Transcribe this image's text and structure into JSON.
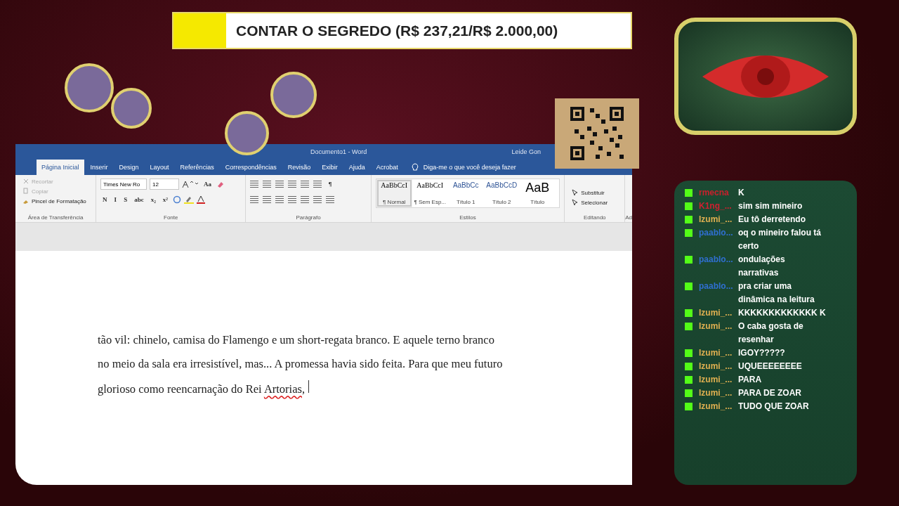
{
  "banner": {
    "title": "CONTAR O SEGREDO (R$ 237,21/R$ 2.000,00)"
  },
  "word": {
    "title": "Documento1 - Word",
    "user": "Leide Gon",
    "tabs": [
      {
        "label": "Página Inicial",
        "selected": true
      },
      {
        "label": "Inserir",
        "selected": false
      },
      {
        "label": "Design",
        "selected": false
      },
      {
        "label": "Layout",
        "selected": false
      },
      {
        "label": "Referências",
        "selected": false
      },
      {
        "label": "Correspondências",
        "selected": false
      },
      {
        "label": "Revisão",
        "selected": false
      },
      {
        "label": "Exibir",
        "selected": false
      },
      {
        "label": "Ajuda",
        "selected": false
      },
      {
        "label": "Acrobat",
        "selected": false
      }
    ],
    "tell_me": {
      "placeholder": "Diga-me o que você deseja fazer"
    },
    "clipboard": {
      "items": [
        {
          "label": "Recortar",
          "disabled": true
        },
        {
          "label": "Copiar",
          "disabled": true
        },
        {
          "label": "Pincel de Formatação",
          "disabled": false
        }
      ],
      "group": "Área de Transferência"
    },
    "font": {
      "name": "Times New Ro",
      "size": "12",
      "case_button": "Aa",
      "format_buttons": [
        "N",
        "I",
        "S",
        "abc",
        "x₂",
        "x²"
      ],
      "group": "Fonte"
    },
    "paragraph": {
      "group": "Parágrafo",
      "pilcrow": "¶"
    },
    "styles": {
      "group": "Estilos",
      "items": [
        {
          "preview": "AaBbCcI",
          "name": "¶ Normal",
          "kind": "body",
          "selected": true
        },
        {
          "preview": "AaBbCcI",
          "name": "¶ Sem Esp...",
          "kind": "body",
          "selected": false
        },
        {
          "preview": "AaBbCc",
          "name": "Título 1",
          "kind": "heading1",
          "selected": false
        },
        {
          "preview": "AaBbCcD",
          "name": "Título 2",
          "kind": "heading2",
          "selected": false
        },
        {
          "preview": "AaB",
          "name": "Título",
          "kind": "title",
          "selected": false
        }
      ]
    },
    "editing": {
      "group": "Editando",
      "items": [
        "Substituir",
        "Selecionar"
      ],
      "cut_label": "Ad"
    },
    "document": {
      "lines": [
        [
          {
            "text": "tão vil: chinelo, camisa do Flamengo e um short-regata branco. E aquele terno branco",
            "misspelled": false
          }
        ],
        [
          {
            "text": "no meio da sala era irresistível, mas... A promessa havia sido feita. Para que meu futuro",
            "misspelled": false
          }
        ],
        [
          {
            "text": "glorioso como reencarnação do Rei ",
            "misspelled": false
          },
          {
            "text": "Artorias",
            "misspelled": true
          },
          {
            "text": ","
          }
        ]
      ]
    }
  },
  "chat": {
    "messages": [
      {
        "user": "rmecna",
        "color": "#c8202c",
        "text": "K"
      },
      {
        "user": "K1ng_...",
        "color": "#d02030",
        "text": "sim sim mineiro"
      },
      {
        "user": "Izumi_...",
        "color": "#e0b050",
        "text": "Eu tô derretendo"
      },
      {
        "user": "paablo...",
        "color": "#2f6fd0",
        "text": "oq o mineiro falou tá certo"
      },
      {
        "user": "paablo...",
        "color": "#2f6fd0",
        "text": "ondulações narrativas"
      },
      {
        "user": "paablo...",
        "color": "#2f6fd0",
        "text": "pra criar uma dinâmica na leitura"
      },
      {
        "user": "Izumi_...",
        "color": "#e0b050",
        "text": "KKKKKKKKKKKKK K"
      },
      {
        "user": "Izumi_...",
        "color": "#e0b050",
        "text": "O caba gosta de resenhar"
      },
      {
        "user": "Izumi_...",
        "color": "#e0b050",
        "text": "IGOY?????"
      },
      {
        "user": "Izumi_...",
        "color": "#e0b050",
        "text": "UQUEEEEEEEE"
      },
      {
        "user": "Izumi_...",
        "color": "#e0b050",
        "text": "PARA"
      },
      {
        "user": "Izumi_...",
        "color": "#e0b050",
        "text": "PARA DE ZOAR"
      },
      {
        "user": "Izumi_...",
        "color": "#e0b050",
        "text": "TUDO QUE ZOAR"
      }
    ]
  }
}
